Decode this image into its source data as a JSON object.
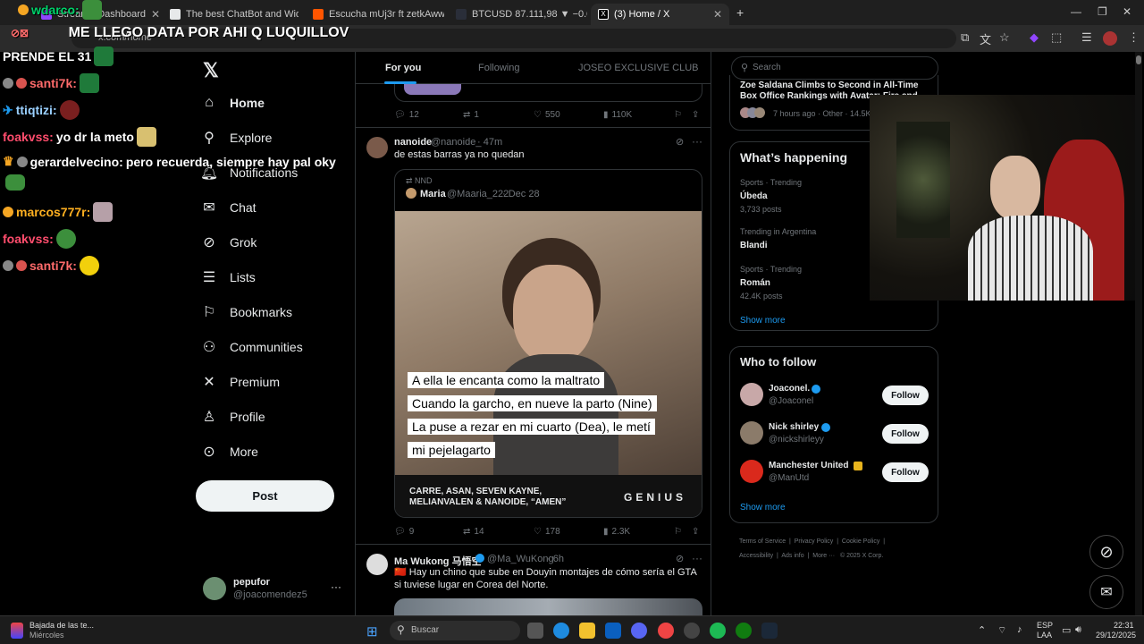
{
  "browser": {
    "tabs": [
      {
        "label": "Stream · Dashboard",
        "active": false
      },
      {
        "label": "The best ChatBot and Widgets",
        "active": false
      },
      {
        "label": "Escucha mUj3r ft zetkAww de g",
        "active": false
      },
      {
        "label": "BTCUSD 87.111,98 ▼ −0.08% S",
        "active": false
      },
      {
        "label": "(3) Home / X",
        "active": true
      }
    ],
    "url": "x.com/home",
    "new_tab": "+",
    "window_controls": [
      "—",
      "❐",
      "✕"
    ]
  },
  "stream_banner": "ME LLEGO DATA POR AHI Q LUQUILLOV",
  "chat": [
    {
      "user": "wdarco:",
      "user_color": "#00d26a",
      "text": ""
    },
    {
      "user": "",
      "user_color": "#ffffff",
      "text": "PRENDE EL 31"
    },
    {
      "user": "santi7k:",
      "user_color": "#ff6b6b",
      "text": ""
    },
    {
      "user": "ttiqtizi:",
      "user_color": "#9ad0ff",
      "text": ""
    },
    {
      "user": "foakvss:",
      "user_color": "#ff4d6d",
      "text": "yo dr la meto"
    },
    {
      "user": "gerardelvecino:",
      "user_color": "#ffffff",
      "text": "pero recuerda, siempre hay pal oky"
    },
    {
      "user": "marcos777r:",
      "user_color": "#ffb020",
      "text": ""
    },
    {
      "user": "foakvss:",
      "user_color": "#ff4d6d",
      "text": ""
    },
    {
      "user": "santi7k:",
      "user_color": "#ff6b6b",
      "text": ""
    }
  ],
  "nav": {
    "items": [
      {
        "label": "Home",
        "icon": "home-icon"
      },
      {
        "label": "Explore",
        "icon": "search-icon"
      },
      {
        "label": "Notifications",
        "icon": "bell-icon"
      },
      {
        "label": "Chat",
        "icon": "mail-icon"
      },
      {
        "label": "Grok",
        "icon": "grok-icon"
      },
      {
        "label": "Lists",
        "icon": "list-icon"
      },
      {
        "label": "Bookmarks",
        "icon": "bookmark-icon"
      },
      {
        "label": "Communities",
        "icon": "people-icon"
      },
      {
        "label": "Premium",
        "icon": "x-logo-icon"
      },
      {
        "label": "Profile",
        "icon": "person-icon"
      },
      {
        "label": "More",
        "icon": "more-circle-icon"
      }
    ],
    "post_button": "Post",
    "account": {
      "name": "pepufor",
      "handle": "@joacomendez5",
      "more": "···"
    }
  },
  "timeline": {
    "tabs": [
      "For you",
      "Following",
      "JOSEO EXCLUSIVE CLUB"
    ],
    "prev_post_actions": {
      "replies": "12",
      "reposts": "1",
      "likes": "550",
      "views": "110K"
    },
    "post1": {
      "name": "nanoide",
      "handle": "@nanoide_",
      "time": "· 47m",
      "text": "de estas barras ya no quedan",
      "quote": {
        "context": "NND",
        "name": "Maria",
        "handle": "@Maaria_222",
        "time": "· Dec 28"
      },
      "lyrics": [
        "A ella le encanta como la maltrato",
        "Cuando la garcho, en nueve la parto (Nine)",
        "La puse a rezar en mi cuarto (Dea), le metí",
        "mi pejelagarto"
      ],
      "credit_line1": "CARRE, ASAN, SEVEN KAYNE,",
      "credit_line2": "MELIANVALEN & NANOIDE, “AMEN”",
      "genius": "GENIUS",
      "actions": {
        "replies": "9",
        "reposts": "14",
        "likes": "178",
        "views": "2.3K"
      }
    },
    "post2": {
      "name": "Ma Wukong 马悟空",
      "handle": "@Ma_WuKong",
      "time": "· 6h",
      "text": "🇨🇳 Hay un chino que sube en Douyin montajes de cómo sería el GTA si tuviese lugar en Corea del Norte."
    }
  },
  "right": {
    "search_placeholder": "Search",
    "trend_top": {
      "title": "Zoe Saldana Climbs to Second in All-Time Box Office Rankings with Avatar: Fire and",
      "meta": "7 hours ago · Other · 14.5K p"
    },
    "whats_happening": {
      "title": "What’s happening",
      "trends": [
        {
          "context": "Sports · Trending",
          "name": "Úbeda",
          "count": "3,733 posts"
        },
        {
          "context": "Trending in Argentina",
          "name": "Blandi",
          "count": ""
        },
        {
          "context": "Sports · Trending",
          "name": "Román",
          "count": "42.4K posts"
        }
      ],
      "show_more": "Show more"
    },
    "who_to_follow": {
      "title": "Who to follow",
      "users": [
        {
          "name": "Joaconel.",
          "handle": "@Joaconel",
          "verified": "blue"
        },
        {
          "name": "Nick shirley",
          "handle": "@nickshirleyy",
          "verified": "blue"
        },
        {
          "name": "Manchester United",
          "handle": "@ManUtd",
          "verified": "gold"
        }
      ],
      "follow_label": "Follow",
      "show_more": "Show more"
    },
    "footer": [
      "Terms of Service",
      "Privacy Policy",
      "Cookie Policy",
      "Accessibility",
      "Ads info",
      "More ···",
      "© 2025 X Corp."
    ]
  },
  "taskbar": {
    "weather_title": "Bajada de las te...",
    "weather_sub": "Miércoles",
    "search": "Buscar",
    "lang": "ESP",
    "lang2": "LAA",
    "time": "22:31",
    "date": "29/12/2025"
  },
  "colors": {
    "accent": "#1d9bf0",
    "gold": "#e8b41d",
    "bg": "#000000",
    "border": "#2f3336",
    "muted": "#71767b"
  }
}
